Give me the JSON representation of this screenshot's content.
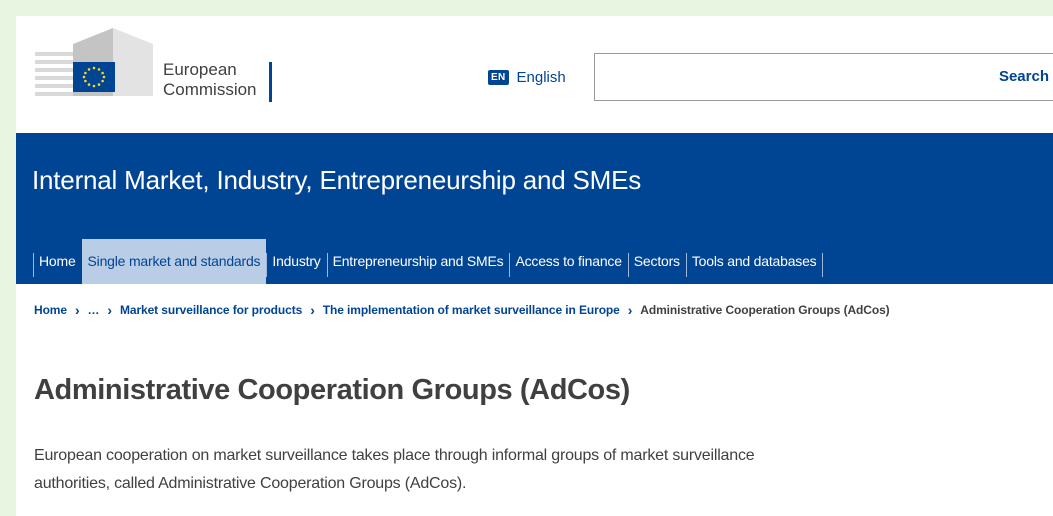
{
  "header": {
    "logo_text_line1": "European",
    "logo_text_line2": "Commission",
    "language_code": "EN",
    "language_label": "English",
    "search_placeholder": "",
    "search_button": "Search"
  },
  "site": {
    "title": "Internal Market, Industry, Entrepreneurship and SMEs"
  },
  "nav": {
    "items": [
      {
        "label": "Home"
      },
      {
        "label": "Single market and standards"
      },
      {
        "label": "Industry"
      },
      {
        "label": "Entrepreneurship and SMEs"
      },
      {
        "label": "Access to finance"
      },
      {
        "label": "Sectors"
      },
      {
        "label": "Tools and databases"
      }
    ],
    "active": "Single market and standards"
  },
  "breadcrumb": {
    "items": [
      "Home",
      "…",
      "Market surveillance for products",
      "The implementation of market surveillance in Europe"
    ],
    "current": "Administrative Cooperation Groups (AdCos)"
  },
  "main": {
    "title": "Administrative Cooperation Groups (AdCos)",
    "intro": "European cooperation on market surveillance takes place through informal groups of market surveillance authorities, called Administrative Cooperation Groups (AdCos)."
  },
  "colors": {
    "brand_blue": "#004494",
    "active_nav_bg": "#b9cde6",
    "frame_bg": "#e8f5e0",
    "flag_yellow": "#ffd617"
  }
}
